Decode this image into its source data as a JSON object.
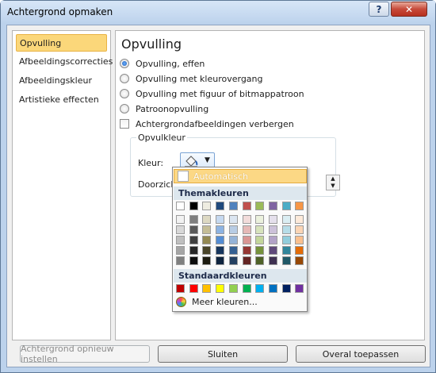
{
  "window": {
    "title": "Achtergrond opmaken",
    "help_label": "?",
    "close_label": "✕"
  },
  "nav": {
    "items": [
      {
        "label": "Opvulling",
        "active": true
      },
      {
        "label": "Afbeeldingscorrecties",
        "active": false
      },
      {
        "label": "Afbeeldingskleur",
        "active": false
      },
      {
        "label": "Artistieke effecten",
        "active": false
      }
    ]
  },
  "panel": {
    "title": "Opvulling",
    "options": [
      {
        "label": "Opvulling, effen",
        "selected": true
      },
      {
        "label": "Opvulling met kleurovergang",
        "selected": false
      },
      {
        "label": "Opvulling met figuur of bitmappatroon",
        "selected": false
      },
      {
        "label": "Patroonopvulling",
        "selected": false
      }
    ],
    "hide_background_label": "Achtergrondafbeeldingen verbergen",
    "hide_background_checked": false,
    "fill_group": {
      "legend": "Opvulkleur",
      "color_label": "Kleur:",
      "transparency_label": "Doorzich"
    }
  },
  "popup": {
    "automatic_label": "Automatisch",
    "theme_header": "Themakleuren",
    "standard_header": "Standaardkleuren",
    "more_colors_label": "Meer kleuren...",
    "theme_top": [
      "#ffffff",
      "#000000",
      "#eeece1",
      "#1f497d",
      "#4f81bd",
      "#c0504d",
      "#9bbb59",
      "#8064a2",
      "#4bacc6",
      "#f79646"
    ],
    "theme_shades": [
      [
        "#f2f2f2",
        "#7f7f7f",
        "#ddd9c3",
        "#c6d9f0",
        "#dbe5f1",
        "#f2dcdb",
        "#ebf1dd",
        "#e5e0ec",
        "#dbeef3",
        "#fdeada"
      ],
      [
        "#d8d8d8",
        "#595959",
        "#c4bd97",
        "#8db3e2",
        "#b8cce4",
        "#e5b9b7",
        "#d7e3bc",
        "#ccc1d9",
        "#b7dde8",
        "#fbd5b5"
      ],
      [
        "#bfbfbf",
        "#3f3f3f",
        "#938953",
        "#548dd4",
        "#95b3d7",
        "#d99694",
        "#c3d69b",
        "#b2a2c7",
        "#92cddc",
        "#fac08f"
      ],
      [
        "#a5a5a5",
        "#262626",
        "#494429",
        "#17365d",
        "#366092",
        "#953734",
        "#76923c",
        "#5f497a",
        "#31859b",
        "#e36c09"
      ],
      [
        "#7f7f7f",
        "#0c0c0c",
        "#1d1b10",
        "#0f243e",
        "#244061",
        "#632423",
        "#4f6128",
        "#3f3151",
        "#205867",
        "#974806"
      ]
    ],
    "standard_colors": [
      "#c00000",
      "#ff0000",
      "#ffc000",
      "#ffff00",
      "#92d050",
      "#00b050",
      "#00b0f0",
      "#0070c0",
      "#002060",
      "#7030a0"
    ]
  },
  "footer": {
    "reset_label": "Achtergrond opnieuw instellen",
    "close_label": "Sluiten",
    "apply_all_label": "Overal toepassen"
  }
}
